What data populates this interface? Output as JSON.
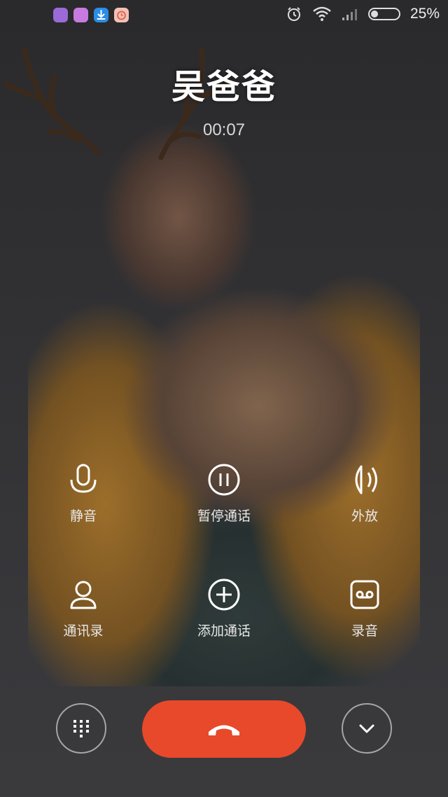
{
  "status_bar": {
    "app_icons": [
      {
        "name": "purple-app-icon",
        "color": "#9b6ad6"
      },
      {
        "name": "pink-app-icon",
        "color": "#c77be0"
      },
      {
        "name": "download-app-icon",
        "color": "#2a8de6"
      },
      {
        "name": "timer-app-icon",
        "color": "#f08c7a"
      }
    ],
    "icons": [
      "alarm-icon",
      "wifi-icon",
      "signal-icon",
      "battery-icon"
    ],
    "battery_level": 0.25,
    "battery_percent": "25%"
  },
  "caller": {
    "name": "吴爸爸",
    "timer": "00:07"
  },
  "actions": [
    {
      "label": "静音",
      "icon": "microphone-icon"
    },
    {
      "label": "暂停通话",
      "icon": "pause-icon"
    },
    {
      "label": "外放",
      "icon": "speaker-icon"
    },
    {
      "label": "通讯录",
      "icon": "contact-icon"
    },
    {
      "label": "添加通话",
      "icon": "add-call-icon"
    },
    {
      "label": "录音",
      "icon": "record-icon"
    }
  ],
  "bottom_bar": {
    "left_icon": "dialpad-icon",
    "center_icon": "hang-up-icon",
    "right_icon": "chevron-down-icon",
    "hangup_color": "#e8492b"
  }
}
